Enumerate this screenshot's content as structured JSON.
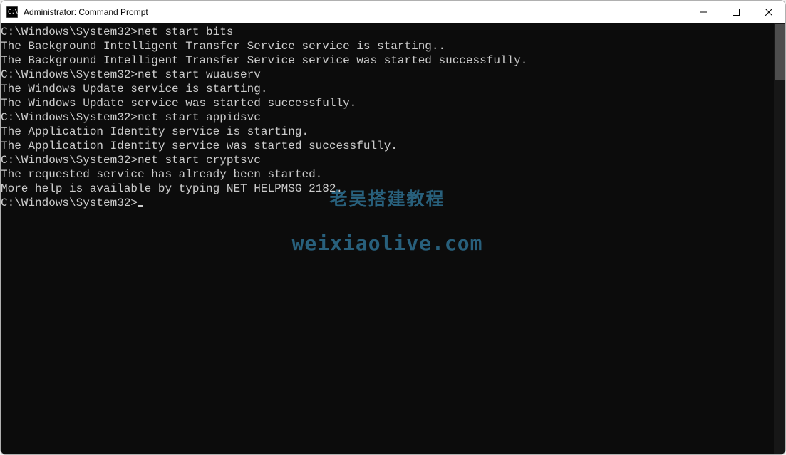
{
  "titlebar": {
    "title": "Administrator: Command Prompt"
  },
  "terminal": {
    "prompt": "C:\\Windows\\System32>",
    "blocks": [
      {
        "command": "net start bits",
        "output": [
          "The Background Intelligent Transfer Service service is starting..",
          "The Background Intelligent Transfer Service service was started successfully.",
          ""
        ]
      },
      {
        "command": "net start wuauserv",
        "output": [
          "The Windows Update service is starting.",
          "The Windows Update service was started successfully.",
          ""
        ]
      },
      {
        "command": "net start appidsvc",
        "output": [
          "The Application Identity service is starting.",
          "The Application Identity service was started successfully.",
          ""
        ]
      },
      {
        "command": "net start cryptsvc",
        "output": [
          "The requested service has already been started.",
          "",
          "More help is available by typing NET HELPMSG 2182.",
          ""
        ]
      }
    ]
  },
  "watermark": {
    "line1": "老吴搭建教程",
    "line2": "weixiaolive.com"
  }
}
